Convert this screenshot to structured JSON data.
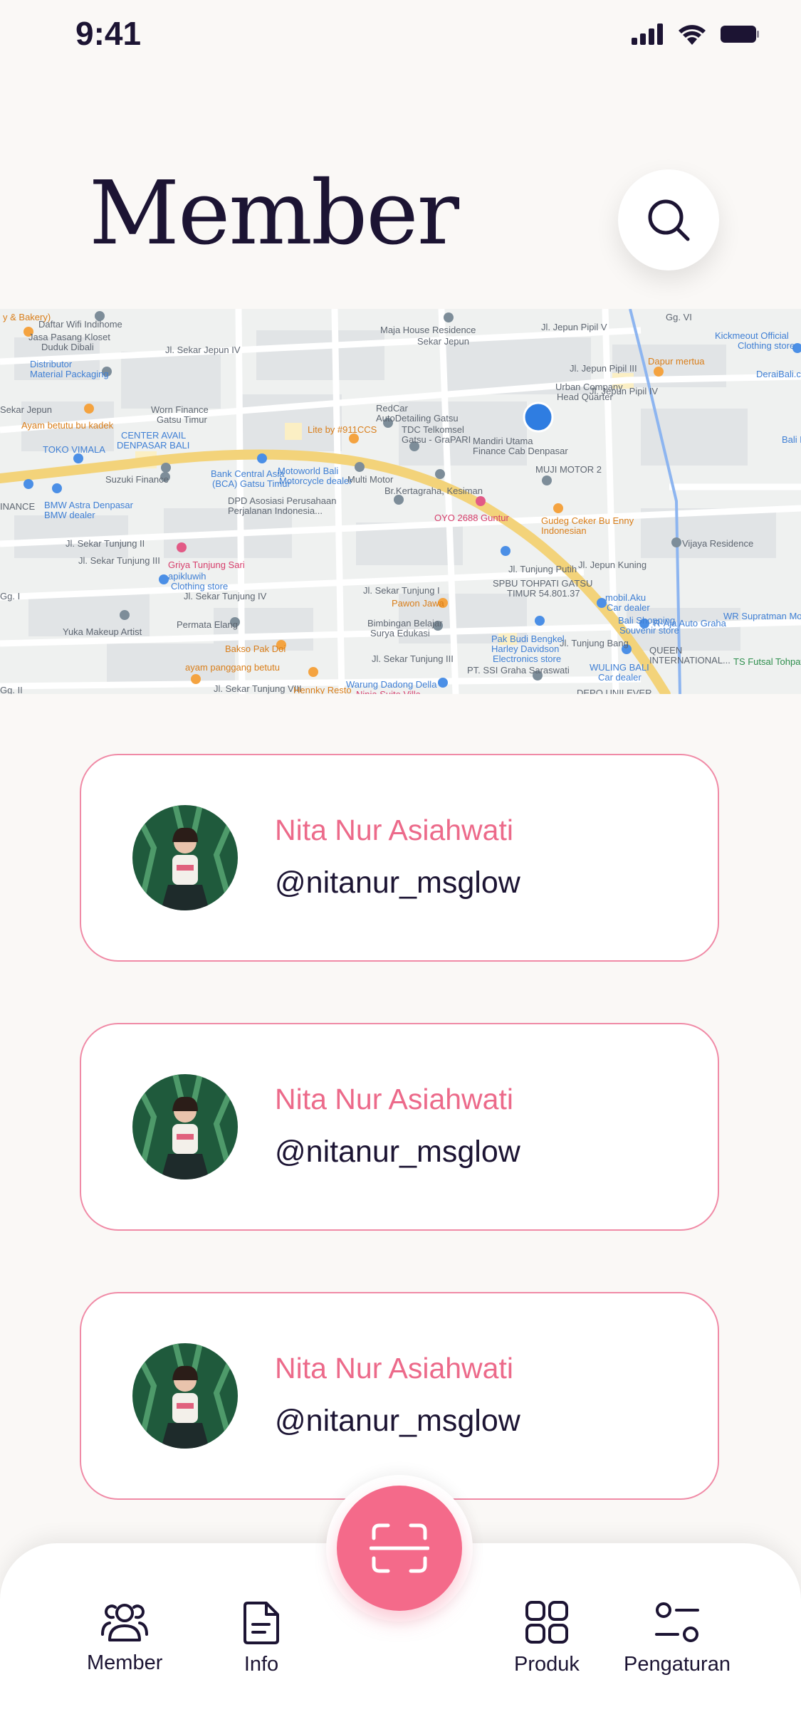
{
  "status_bar": {
    "time": "9:41"
  },
  "header": {
    "title": "Member"
  },
  "map": {
    "labels": [
      "y & Bakery)",
      "Daftar Wifi Indihome",
      "Maja House Residence",
      "Sekar Jepun",
      "Gg. VI",
      "Jl. Jepun Pipil V",
      "Kickmeout Official",
      "Clothing store",
      "Jasa Pasang Kloset",
      "Duduk Dibali",
      "Jl. Sekar Jepun IV",
      "Dapur mertua",
      "Jl. Jepun Pipil III",
      "DeraiBali.com",
      "Distributor",
      "Material Packaging",
      "Jl. Jepun Pipil IV",
      "Urban Company",
      "Head Quarter",
      "Sekar Jepun",
      "Worn Finance",
      "Gatsu Timur",
      "RedCar",
      "AutoDetailing Gatsu",
      "Ayam betutu bu kadek",
      "CENTER AVAIL",
      "DENPASAR BALI",
      "Lite by #911CCS",
      "TDC Telkomsel",
      "Gatsu - GraPARI",
      "Mandiri Utama",
      "Finance Cab Denpasar",
      "Bali E",
      "TOKO VIMALA",
      "Suzuki Finance",
      "Motoworld Bali",
      "Motorcycle dealer",
      "MUJI MOTOR 2",
      "Bank Central Asia",
      "(BCA) Gatsu Timur",
      "Multi Motor",
      "Br.Kertagraha, Kesiman",
      "INANCE",
      "BMW Astra Denpasar",
      "BMW dealer",
      "DPD Asosiasi Perusahaan",
      "Perjalanan Indonesia...",
      "OYO 2688 Guntur",
      "Gudeg Ceker Bu Enny",
      "Indonesian",
      "Vijaya Residence",
      "Jl. Sekar Tunjung II",
      "Jl. Sekar Tunjung III",
      "Griya Tunjung Sari",
      "apikluwih",
      "Clothing store",
      "Jl. Tunjung Putih",
      "Jl. Jepun Kuning",
      "SPBU TOHPATI GATSU",
      "TIMUR 54.801.37",
      "mobil.Aku",
      "Car dealer",
      "Gg. I",
      "Jl. Sekar Tunjung IV",
      "Jl. Sekar Tunjung I",
      "Pawon Jawa",
      "WR Supratman Motor",
      "Bali Shopping",
      "Souvenir store",
      "R-Aja Auto Graha",
      "Yuka Makeup Artist",
      "Permata Elang",
      "Bimbingan Belajar",
      "Surya Edukasi",
      "Jl. Tunjung Bang",
      "Pak Budi Bengkel",
      "Harley Davidson",
      "Electronics store",
      "QUEEN",
      "INTERNATIONAL...",
      "TS Futsal Tohpati",
      "Bakso Pak Doi",
      "ayam panggang betutu",
      "PT. SSI Graha Saraswati",
      "WULING BALI",
      "Car dealer",
      "Gg. II",
      "Jl. Sekar Tunjung VIII",
      "Jl. Sekar Tunjung III",
      "Hennky Resto",
      "Warung Dadong Della",
      "Ninja Suite Villa",
      "DEPO UNILEVER"
    ]
  },
  "members": [
    {
      "name": "Nita Nur Asiahwati",
      "handle": "@nitanur_msglow"
    },
    {
      "name": "Nita Nur Asiahwati",
      "handle": "@nitanur_msglow"
    },
    {
      "name": "Nita Nur Asiahwati",
      "handle": "@nitanur_msglow"
    }
  ],
  "nav": {
    "member": "Member",
    "info": "Info",
    "produk": "Produk",
    "pengaturan": "Pengaturan"
  },
  "icons": {
    "search": "search-icon",
    "scan": "scan-icon",
    "member": "users-icon",
    "info": "document-icon",
    "produk": "grid-icon",
    "pengaturan": "settings-icon"
  },
  "colors": {
    "primary": "#f46a8a",
    "card_border": "#f08aa6",
    "member_name": "#ec6a8a",
    "dark": "#1c1433",
    "background": "#faf8f6",
    "map_location": "#2f7de1"
  }
}
